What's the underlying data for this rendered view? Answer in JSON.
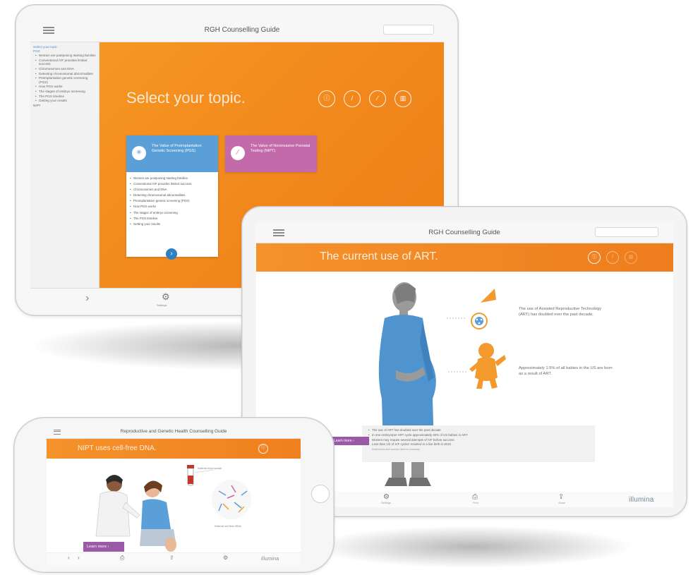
{
  "tablet_topics": {
    "title": "RGH Counselling Guide",
    "sidebar": {
      "heading": "Select your topic",
      "section": "PGS",
      "items": [
        "Women are postponing starting families",
        "Conventional IVF provides limited success",
        "Chromosomes and DNA",
        "Detecting chromosomal abnormalities",
        "Preimplantation genetic screening (PGS)",
        "How PGS works",
        "The stages of embryo screening",
        "The PGS timeline",
        "Getting your results"
      ],
      "footer": "NIPT"
    },
    "headline": "Select your topic.",
    "toolbar_icons": [
      "info-icon",
      "pipette-icon",
      "test-tube-icon",
      "chart-icon"
    ],
    "cards": [
      {
        "title": "The Value of Preimplantation Genetic Screening (PGS)",
        "items": [
          "Women are postponing starting families",
          "Conventional IVF provides limited success",
          "Chromosomes and DNA",
          "Detecting chromosomal abnormalities",
          "Preimplantation genetic screening (PGS)",
          "How PGS works",
          "The stages of embryo screening",
          "The PGS timeline",
          "Getting your results"
        ]
      },
      {
        "title": "The Value of Noninvasive Prenatal Testing (NIPT)"
      }
    ],
    "bottom_label": "Settings"
  },
  "tablet_art": {
    "title": "RGH Counselling Guide",
    "headline": "The current use of ART.",
    "facts": [
      "The use of Assisted Reproductive Technology (ART) has doubled over the past decade.",
      "Approximately 1.5% of all babies in the US are born as a result of ART."
    ],
    "summary": [
      "The use of ART has doubled over the past decade",
      "In one embryo/per ART cycle approximately 40% of US babies in ART",
      "Women may require several attempts of IVF before success",
      "Less than 1/3 of IVF cycles' resulted in a live birth in 2010"
    ],
    "summary_source": "References and sources listed in summary",
    "learn_more": "Learn more",
    "bottom_labels": [
      "Settings",
      "Print",
      "Share"
    ],
    "brand": "illumina"
  },
  "phone": {
    "title": "Reproductive and Genetic Health Counselling Guide",
    "headline": "NIPT uses cell-free DNA.",
    "learn_more": "Learn more",
    "caption_tube": "Maternal blood sample",
    "caption_dna": "Maternal and fetal cfDNA",
    "brand": "illumina"
  },
  "colors": {
    "orange": "#f28a1d",
    "blue_card": "#5b9fd8",
    "pink_card": "#c36aaa",
    "purple_button": "#9b5aa8",
    "figure_blue": "#4f93cf",
    "baby_orange": "#f29a2e"
  }
}
